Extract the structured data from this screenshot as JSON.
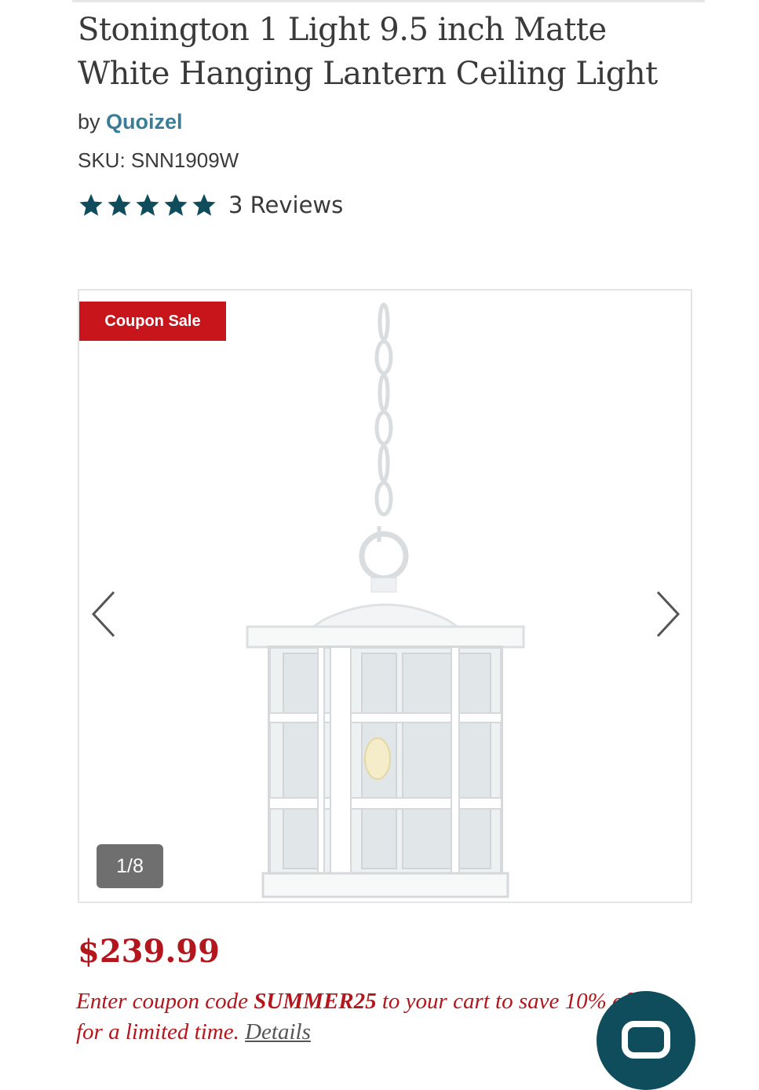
{
  "product": {
    "title": "Stonington 1 Light 9.5 inch Matte White Hanging Lantern Ceiling Light",
    "by_label": "by",
    "brand": "Quoizel",
    "sku_label": "SKU:",
    "sku": "SNN1909W",
    "rating_stars": 5,
    "reviews_label": "3 Reviews"
  },
  "gallery": {
    "badge": "Coupon Sale",
    "counter": "1/8",
    "prev_icon": "chevron-left-icon",
    "next_icon": "chevron-right-icon"
  },
  "pricing": {
    "price": "$239.99",
    "coupon_prefix": "Enter coupon code ",
    "coupon_code": "SUMMER25",
    "coupon_suffix": " to your cart to save 10% off",
    "coupon_line2": "for a limited time. ",
    "details_link": "Details"
  },
  "colors": {
    "accent_red": "#c8151b",
    "price_red": "#b3161c",
    "brand_link": "#3b7d98",
    "star": "#0f4c5c",
    "chat_button": "#0f4c5c"
  },
  "chat": {
    "icon": "chat-icon"
  }
}
